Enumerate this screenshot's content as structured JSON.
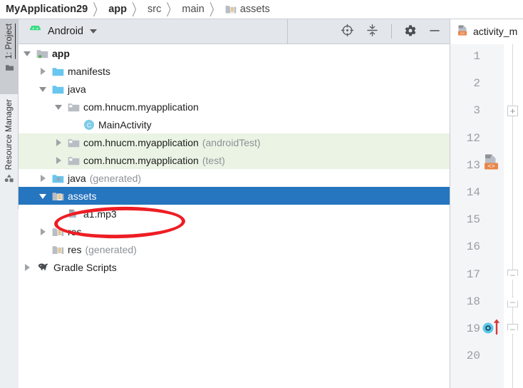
{
  "breadcrumb": {
    "name": "breadcrumb",
    "items": [
      {
        "label": "MyApplication29",
        "bold": true,
        "icon": "none"
      },
      {
        "label": "app",
        "bold": true,
        "icon": "none"
      },
      {
        "label": "src",
        "bold": false,
        "icon": "none"
      },
      {
        "label": "main",
        "bold": false,
        "icon": "none"
      },
      {
        "label": "assets",
        "bold": false,
        "icon": "assets-folder-icon"
      }
    ],
    "separator": "〉"
  },
  "left_strip": {
    "project_tab_label": "1: Project",
    "resource_tab_label": "Resource Manager"
  },
  "panel": {
    "title": "Android",
    "chevron": "chevron-down-icon",
    "tools": [
      {
        "name": "locate-target-icon",
        "label": ""
      },
      {
        "name": "collapse-all-icon",
        "label": ""
      },
      {
        "name": "settings-gear-icon",
        "label": ""
      },
      {
        "name": "hide-panel-icon",
        "label": ""
      }
    ]
  },
  "tree": {
    "rows": [
      {
        "label": "app",
        "suffix": "",
        "depth": 0,
        "twisty": "open",
        "icon": "module-folder-icon",
        "bold": true,
        "state": "normal"
      },
      {
        "label": "manifests",
        "suffix": "",
        "depth": 1,
        "twisty": "closed",
        "icon": "blue-folder-icon",
        "bold": false,
        "state": "normal"
      },
      {
        "label": "java",
        "suffix": "",
        "depth": 1,
        "twisty": "open",
        "icon": "blue-folder-icon",
        "bold": false,
        "state": "normal"
      },
      {
        "label": "com.hnucm.myapplication",
        "suffix": "",
        "depth": 2,
        "twisty": "open",
        "icon": "package-icon",
        "bold": false,
        "state": "normal"
      },
      {
        "label": "MainActivity",
        "suffix": "",
        "depth": 3,
        "twisty": "none",
        "icon": "class-c-icon",
        "bold": false,
        "state": "normal"
      },
      {
        "label": "com.hnucm.myapplication",
        "suffix": "(androidTest)",
        "depth": 2,
        "twisty": "closed",
        "icon": "package-icon",
        "bold": false,
        "state": "green"
      },
      {
        "label": "com.hnucm.myapplication",
        "suffix": "(test)",
        "depth": 2,
        "twisty": "closed",
        "icon": "package-icon",
        "bold": false,
        "state": "green"
      },
      {
        "label": "java",
        "suffix": "(generated)",
        "depth": 1,
        "twisty": "closed",
        "icon": "generated-java-icon",
        "bold": false,
        "state": "normal"
      },
      {
        "label": "assets",
        "suffix": "",
        "depth": 1,
        "twisty": "open",
        "icon": "assets-folder-icon",
        "bold": false,
        "state": "selected"
      },
      {
        "label": "a1.mp3",
        "suffix": "",
        "depth": 2,
        "twisty": "none",
        "icon": "unknown-file-icon",
        "bold": false,
        "state": "normal"
      },
      {
        "label": "res",
        "suffix": "",
        "depth": 1,
        "twisty": "closed",
        "icon": "res-folder-icon",
        "bold": false,
        "state": "normal"
      },
      {
        "label": "res",
        "suffix": "(generated)",
        "depth": 1,
        "twisty": "none",
        "icon": "res-folder-icon",
        "bold": false,
        "state": "normal"
      },
      {
        "label": "Gradle Scripts",
        "suffix": "",
        "depth": 0,
        "twisty": "closed",
        "icon": "gradle-elephant-icon",
        "bold": false,
        "state": "normal"
      }
    ]
  },
  "annotation": {
    "shape": "red-ellipse",
    "color": "#ee1d24",
    "targets": "a1.mp3"
  },
  "editor": {
    "tab_label": "activity_m",
    "tab_icon": "layout-xml-file-icon",
    "line_numbers": [
      "1",
      "2",
      "3",
      "12",
      "13",
      "14",
      "15",
      "16",
      "17",
      "18",
      "19",
      "20"
    ],
    "gutter_badge_line": "13",
    "gutter_badge_icon": "layout-preview-icon",
    "breakpoint_line": "19",
    "breakpoint_icon": "breakpoint-icon",
    "run_arrow_icon": "red-up-arrow-icon",
    "fold_markers": [
      {
        "line": "3",
        "type": "plus",
        "glyph": "+"
      },
      {
        "line": "17",
        "type": "down",
        "glyph": "–"
      },
      {
        "line": "18",
        "type": "up",
        "glyph": "–"
      },
      {
        "line": "19",
        "type": "down",
        "glyph": "–"
      }
    ]
  },
  "colors": {
    "selection_blue": "#2675bf",
    "test_source_green": "#eaf3e4",
    "annotation_red": "#ee1d24",
    "panel_header": "#e3e6eb",
    "gutter_bg": "#f4f5f7",
    "android_green": "#3ddc84"
  }
}
